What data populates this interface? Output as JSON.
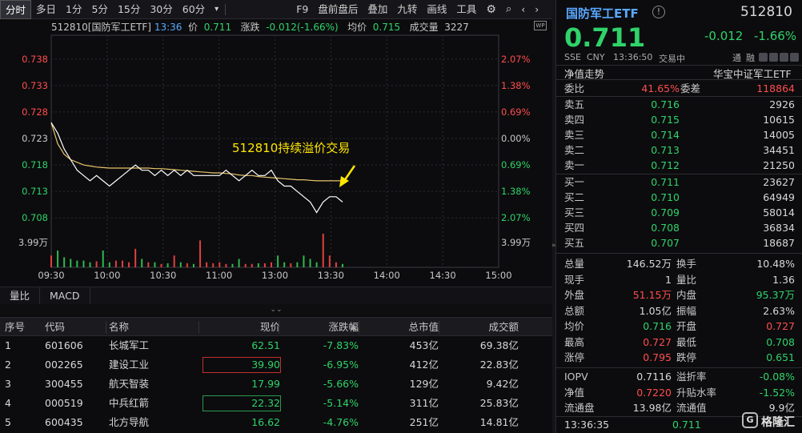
{
  "toolbar": {
    "tabs": [
      "分时",
      "多日",
      "1分",
      "5分",
      "15分",
      "30分",
      "60分"
    ],
    "active": "分时",
    "dropdown": "▾",
    "right_items": [
      "F9",
      "盘前盘后",
      "叠加",
      "九转",
      "画线",
      "工具"
    ]
  },
  "chart_info": {
    "code_name": "512810[国防军工ETF]",
    "time": "13:36",
    "price_label": "价",
    "price": "0.711",
    "change_label": "涨跌",
    "change": "-0.012(-1.66%)",
    "avg_label": "均价",
    "avg": "0.715",
    "vol_label": "成交量",
    "vol": "3227",
    "wp_icon": "WP"
  },
  "chart_data": {
    "type": "line",
    "x_ticks": [
      "09:30",
      "10:00",
      "10:30",
      "11:00",
      "13:00",
      "13:30",
      "14:00",
      "14:30",
      "15:00"
    ],
    "y_ticks_left": [
      "0.738",
      "0.733",
      "0.728",
      "0.723",
      "0.718",
      "0.713",
      "0.708"
    ],
    "y_ticks_right": [
      "2.07%",
      "1.38%",
      "0.69%",
      "0.00%",
      "0.69%",
      "1.38%",
      "2.07%"
    ],
    "ylim": [
      0.7035,
      0.7425
    ],
    "prev_close": 0.723,
    "volume_label": "3.99万",
    "annotation": "512810持续溢价交易",
    "series": [
      {
        "name": "",
        "values": [
          0.726,
          0.724,
          0.721,
          0.719,
          0.717,
          0.716,
          0.715,
          0.716,
          0.715,
          0.714,
          0.715,
          0.716,
          0.717,
          0.718,
          0.717,
          0.717,
          0.716,
          0.717,
          0.716,
          0.717,
          0.716,
          0.717,
          0.716,
          0.716,
          0.716,
          0.716,
          0.716,
          0.717,
          0.716,
          0.715,
          0.716,
          0.717,
          0.716,
          0.716,
          0.717,
          0.715,
          0.714,
          0.714,
          0.713,
          0.712,
          0.711,
          0.709,
          0.711,
          0.712,
          0.712,
          0.711
        ]
      },
      {
        "name": "",
        "values": [
          0.726,
          0.722,
          0.72,
          0.719,
          0.7185,
          0.718,
          0.7178,
          0.7176,
          0.7175,
          0.7174,
          0.7174,
          0.7174,
          0.7174,
          0.7174,
          0.7174,
          0.7174,
          0.7173,
          0.7173,
          0.7172,
          0.7171,
          0.717,
          0.7169,
          0.7168,
          0.7167,
          0.7166,
          0.7165,
          0.7165,
          0.7164,
          0.7163,
          0.7161,
          0.716,
          0.716,
          0.7158,
          0.7157,
          0.7156,
          0.7155,
          0.7154,
          0.7153,
          0.7152,
          0.7152,
          0.7151,
          0.715,
          0.715,
          0.715,
          0.715,
          0.715
        ]
      }
    ],
    "volume_values": [
      0.35,
      0.5,
      0.3,
      0.25,
      0.2,
      0.2,
      0.15,
      0.18,
      0.5,
      0.15,
      0.2,
      0.2,
      0.15,
      0.55,
      0.25,
      0.15,
      0.15,
      0.1,
      0.12,
      0.35,
      0.15,
      0.12,
      0.1,
      0.8,
      0.15,
      0.12,
      0.15,
      0.1,
      0.1,
      0.25,
      0.1,
      0.1,
      0.12,
      0.12,
      0.15,
      0.35,
      0.15,
      0.12,
      0.15,
      0.35,
      0.25,
      0.15,
      1.0,
      0.35,
      0.15,
      0.1
    ]
  },
  "sub_tabs": [
    "量比",
    "MACD"
  ],
  "table": {
    "headers": [
      "序号",
      "代码",
      "名称",
      "现价",
      "涨跌幅",
      "总市值",
      "成交额"
    ],
    "sort_arrow": "▲",
    "rows": [
      {
        "idx": "1",
        "code": "601606",
        "name": "长城军工",
        "price": "62.51",
        "pct": "-7.83%",
        "cap": "453亿",
        "amount": "69.38亿",
        "box": ""
      },
      {
        "idx": "2",
        "code": "002265",
        "name": "建设工业",
        "price": "39.90",
        "pct": "-6.95%",
        "cap": "412亿",
        "amount": "22.83亿",
        "box": "#c03030"
      },
      {
        "idx": "3",
        "code": "300455",
        "name": "航天智装",
        "price": "17.99",
        "pct": "-5.66%",
        "cap": "129亿",
        "amount": "9.42亿",
        "box": ""
      },
      {
        "idx": "4",
        "code": "000519",
        "name": "中兵红箭",
        "price": "22.32",
        "pct": "-5.14%",
        "cap": "311亿",
        "amount": "25.83亿",
        "box": "#2a9a50"
      },
      {
        "idx": "5",
        "code": "600435",
        "name": "北方导航",
        "price": "16.62",
        "pct": "-4.76%",
        "cap": "251亿",
        "amount": "14.81亿",
        "box": ""
      }
    ]
  },
  "quote": {
    "name": "国防军工ETF",
    "info_icon": "!",
    "code": "512810",
    "price": "0.711",
    "change": "-0.012",
    "pct": "-1.66%",
    "exchange": "SSE",
    "currency": "CNY",
    "time": "13:36:50",
    "status": "交易中",
    "tags": [
      "通",
      "融"
    ],
    "nav_trend": "净值走势",
    "index": "华宝中证军工ETF",
    "weibi_label": "委比",
    "weibi": "41.65%",
    "weicha_label": "委差",
    "weicha": "118864",
    "asks": [
      {
        "label": "卖五",
        "price": "0.716",
        "vol": "2926"
      },
      {
        "label": "卖四",
        "price": "0.715",
        "vol": "10615"
      },
      {
        "label": "卖三",
        "price": "0.714",
        "vol": "14005"
      },
      {
        "label": "卖二",
        "price": "0.713",
        "vol": "34451"
      },
      {
        "label": "卖一",
        "price": "0.712",
        "vol": "21250"
      }
    ],
    "bids": [
      {
        "label": "买一",
        "price": "0.711",
        "vol": "23627"
      },
      {
        "label": "买二",
        "price": "0.710",
        "vol": "64949"
      },
      {
        "label": "买三",
        "price": "0.709",
        "vol": "58014"
      },
      {
        "label": "买四",
        "price": "0.708",
        "vol": "36834"
      },
      {
        "label": "买五",
        "price": "0.707",
        "vol": "18687"
      }
    ],
    "stats": [
      {
        "l1": "总量",
        "v1": "146.52万",
        "c1": "white",
        "l2": "换手",
        "v2": "10.48%",
        "c2": "white"
      },
      {
        "l1": "现手",
        "v1": "1",
        "c1": "white",
        "l2": "量比",
        "v2": "1.36",
        "c2": "white"
      },
      {
        "l1": "外盘",
        "v1": "51.15万",
        "c1": "red",
        "l2": "内盘",
        "v2": "95.37万",
        "c2": "green"
      },
      {
        "l1": "总额",
        "v1": "1.05亿",
        "c1": "white",
        "l2": "振幅",
        "v2": "2.63%",
        "c2": "white"
      },
      {
        "l1": "均价",
        "v1": "0.716",
        "c1": "green",
        "l2": "开盘",
        "v2": "0.727",
        "c2": "red"
      },
      {
        "l1": "最高",
        "v1": "0.727",
        "c1": "red",
        "l2": "最低",
        "v2": "0.708",
        "c2": "green"
      },
      {
        "l1": "涨停",
        "v1": "0.795",
        "c1": "red",
        "l2": "跌停",
        "v2": "0.651",
        "c2": "green"
      }
    ],
    "stats2": [
      {
        "l1": "IOPV",
        "v1": "0.7116",
        "c1": "white",
        "l2": "溢折率",
        "v2": "-0.08%",
        "c2": "green"
      },
      {
        "l1": "净值",
        "v1": "0.7220",
        "c1": "red",
        "l2": "升贴水率",
        "v2": "-1.52%",
        "c2": "green"
      },
      {
        "l1": "流通盘",
        "v1": "13.98亿",
        "c1": "white",
        "l2": "流通值",
        "v2": "9.9亿",
        "c2": "white"
      }
    ],
    "tick_time": "13:36:35",
    "tick_price": "0.711",
    "watermark": "格隆汇"
  },
  "colors": {
    "green": "#2fd36a",
    "red": "#ff4d4d",
    "blue": "#59a8ff",
    "avg_line": "#e8c46a",
    "price_line": "#ffffff",
    "vol_green": "#2fb84f",
    "vol_red": "#e04040",
    "arrow": "#ffe600"
  }
}
